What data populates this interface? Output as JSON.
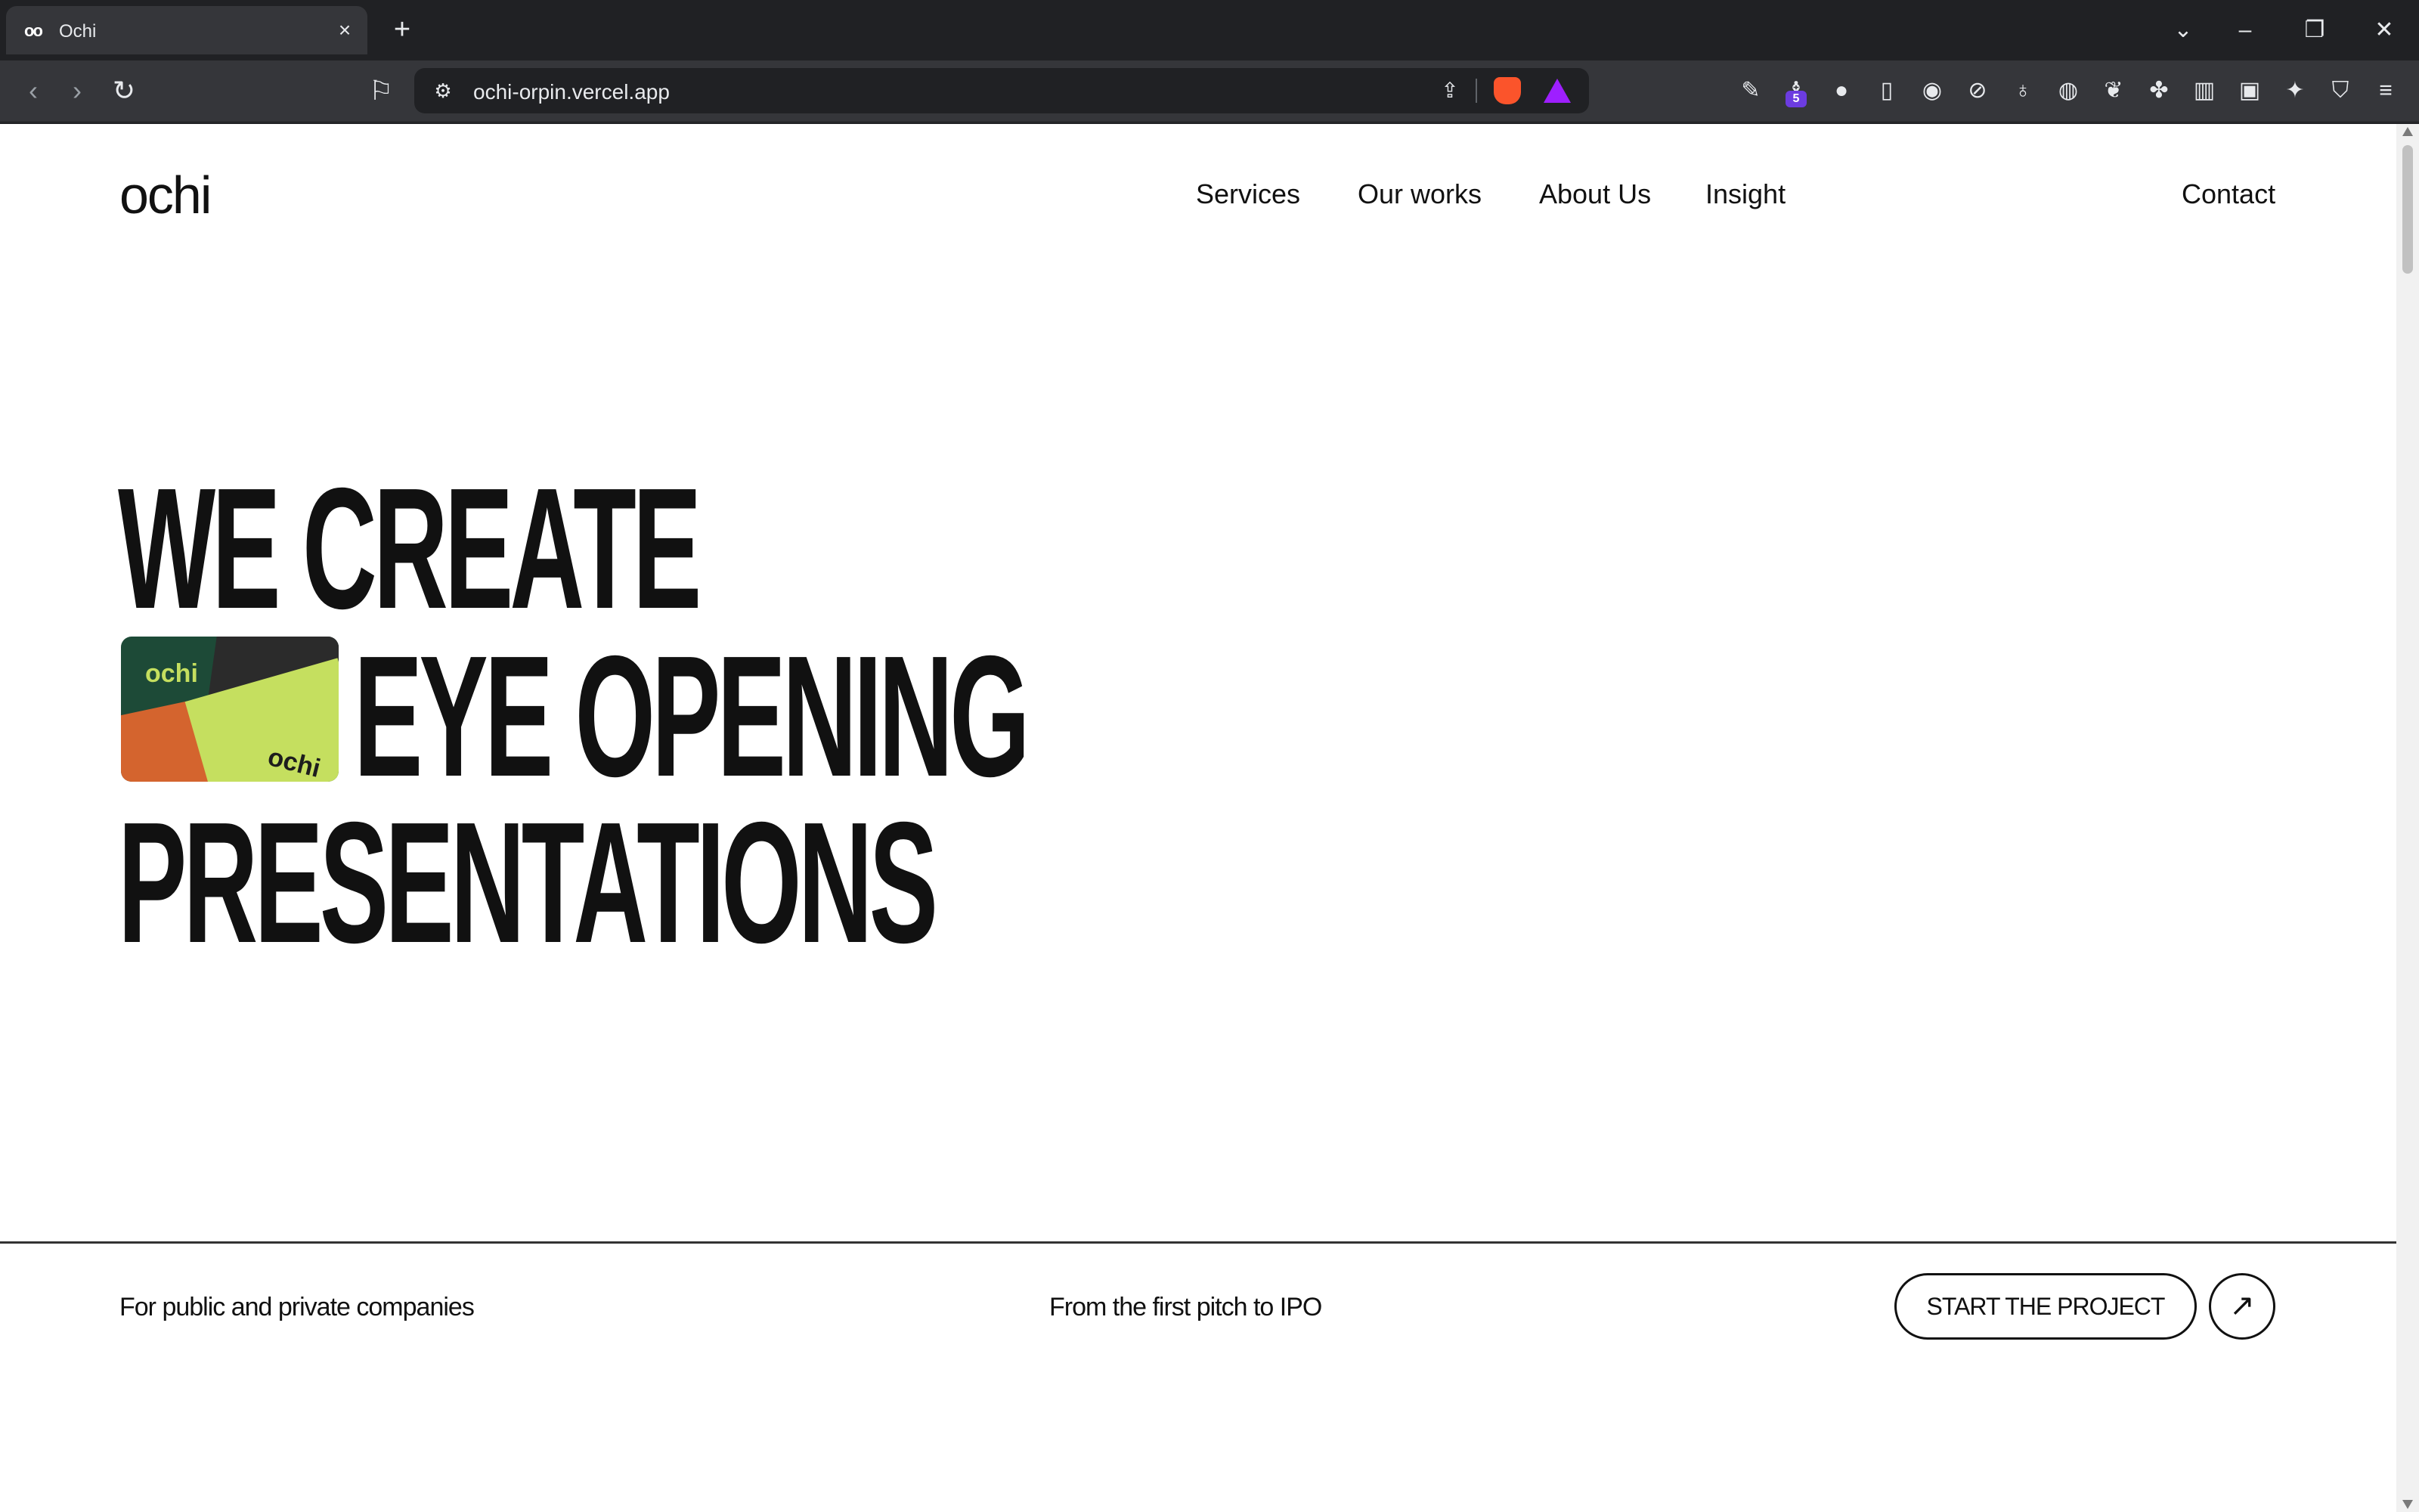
{
  "browser": {
    "tab_title": "Ochi",
    "tab_favicon": "oo",
    "url": "ochi-orpin.vercel.app",
    "extension_badge": "5"
  },
  "site": {
    "logo": "ochi",
    "nav": {
      "services": "Services",
      "works": "Our works",
      "about": "About Us",
      "insight": "Insight",
      "contact": "Contact"
    },
    "hero": {
      "line1": "WE CREATE",
      "line2": "EYE OPENING",
      "line3": "PRESENTATIONS",
      "image_text_top": "ochi",
      "image_text_bottom": "ochi"
    },
    "footer": {
      "left": "For public and private companies",
      "middle": "From the first pitch to IPO",
      "cta": "START THE PROJECT"
    }
  },
  "icons": {
    "back": "chevron-left-icon",
    "forward": "chevron-right-icon",
    "reload": "reload-icon",
    "bookmark": "bookmark-icon",
    "site_info": "tune-icon",
    "share": "share-icon",
    "cta_arrow": "arrow-up-right-icon"
  },
  "colors": {
    "chrome_dark": "#202124",
    "chrome_toolbar": "#35363a",
    "page_bg": "#ffffff",
    "text": "#111111",
    "card_green": "#1d4a37",
    "card_lime": "#c5df5f",
    "card_orange": "#d4642e"
  }
}
